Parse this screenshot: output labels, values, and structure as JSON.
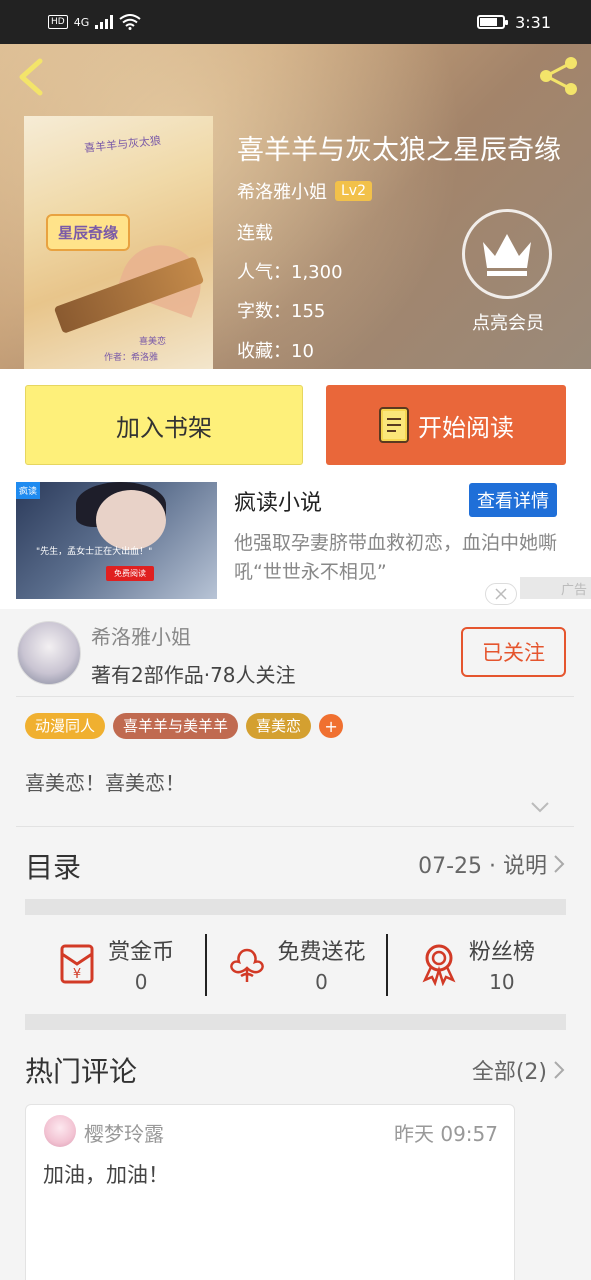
{
  "status_bar": {
    "net_hd": "HD",
    "net_4g": "4G",
    "time": "3:31"
  },
  "book": {
    "title": "喜羊羊与灰太狼之星辰奇缘",
    "author": "希洛雅小姐",
    "level": "Lv2",
    "status": "连载",
    "popularity_label": "人气：",
    "popularity": "1,300",
    "words_label": "字数：",
    "words": "155",
    "favorites_label": "收藏：",
    "favorites": "10",
    "vip_label": "点亮会员",
    "cover": {
      "title": "喜羊羊与灰太狼",
      "tag": "星辰奇缘",
      "author_line": "作者：希洛雅",
      "author_small": "喜美恋"
    }
  },
  "actions": {
    "add_shelf": "加入书架",
    "start_read": "开始阅读"
  },
  "ad": {
    "badge": "疯读",
    "title": "疯读小说",
    "detail_btn": "查看详情",
    "desc": "他强取孕妻脐带血救初恋，血泊中她嘶吼“世世永不相见”",
    "caption": "\"先生，孟女士正在大出血！\"",
    "cta": "免费阅读",
    "mark": "广告"
  },
  "author_card": {
    "name": "希洛雅小姐",
    "stats": "著有2部作品·78人关注",
    "follow": "已关注"
  },
  "tags": [
    {
      "label": "动漫同人",
      "color": "#f0b030"
    },
    {
      "label": "喜羊羊与美羊羊",
      "color": "#c06a50"
    },
    {
      "label": "喜美恋",
      "color": "#d4a030"
    }
  ],
  "summary": "喜美恋！喜美恋！",
  "catalog": {
    "title": "目录",
    "latest": "07-25 · 说明"
  },
  "rewards": [
    {
      "label": "赏金币",
      "value": "0",
      "icon": "red-envelope-icon"
    },
    {
      "label": "免费送花",
      "value": "0",
      "icon": "flower-icon"
    },
    {
      "label": "粉丝榜",
      "value": "10",
      "icon": "medal-icon"
    }
  ],
  "hot_comments": {
    "title": "热门评论",
    "all": "全部(2)",
    "items": [
      {
        "user": "樱梦玲露",
        "time": "昨天 09:57",
        "text": "加油，加油！"
      }
    ]
  },
  "colors": {
    "accent_orange": "#e9673a",
    "shelf_yellow": "#fef07a",
    "follow_red": "#e5552e"
  }
}
